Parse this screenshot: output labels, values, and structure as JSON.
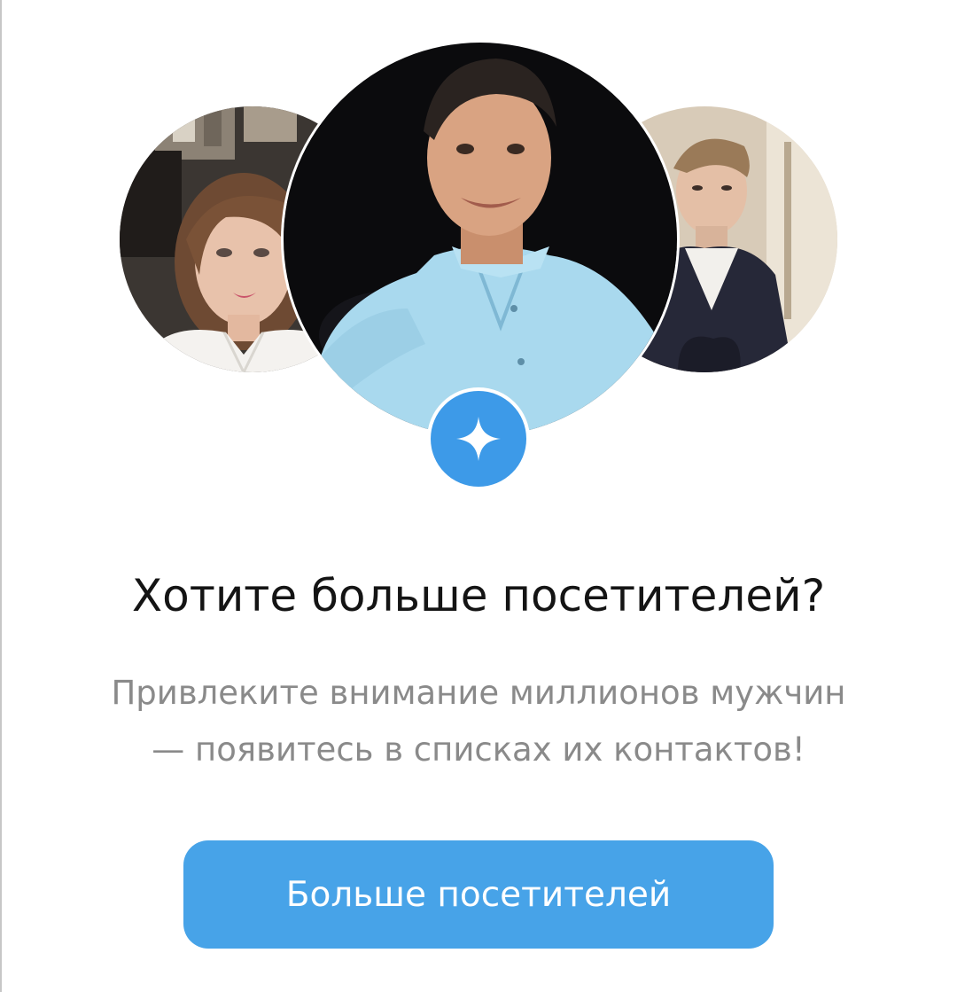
{
  "promo": {
    "headline": "Хотите больше посетителей?",
    "subtitle_line1": "Привлеките внимание миллионов мужчин",
    "subtitle_line2": "— появитесь в списках их контактов!",
    "button_label": "Больше посетителей"
  },
  "badge": {
    "icon": "sparkle-star-icon",
    "color": "#3d9ae8"
  },
  "avatars": [
    {
      "position": "left",
      "subject": "woman with shoulder-length hair, white blouse"
    },
    {
      "position": "center",
      "subject": "smiling man in light blue shirt, dark background"
    },
    {
      "position": "right",
      "subject": "young man in dark hoodie over white t-shirt"
    }
  ],
  "colors": {
    "accent": "#47a3e8",
    "headline_text": "#141414",
    "subtitle_text": "#8a8a8a",
    "background": "#ffffff"
  }
}
